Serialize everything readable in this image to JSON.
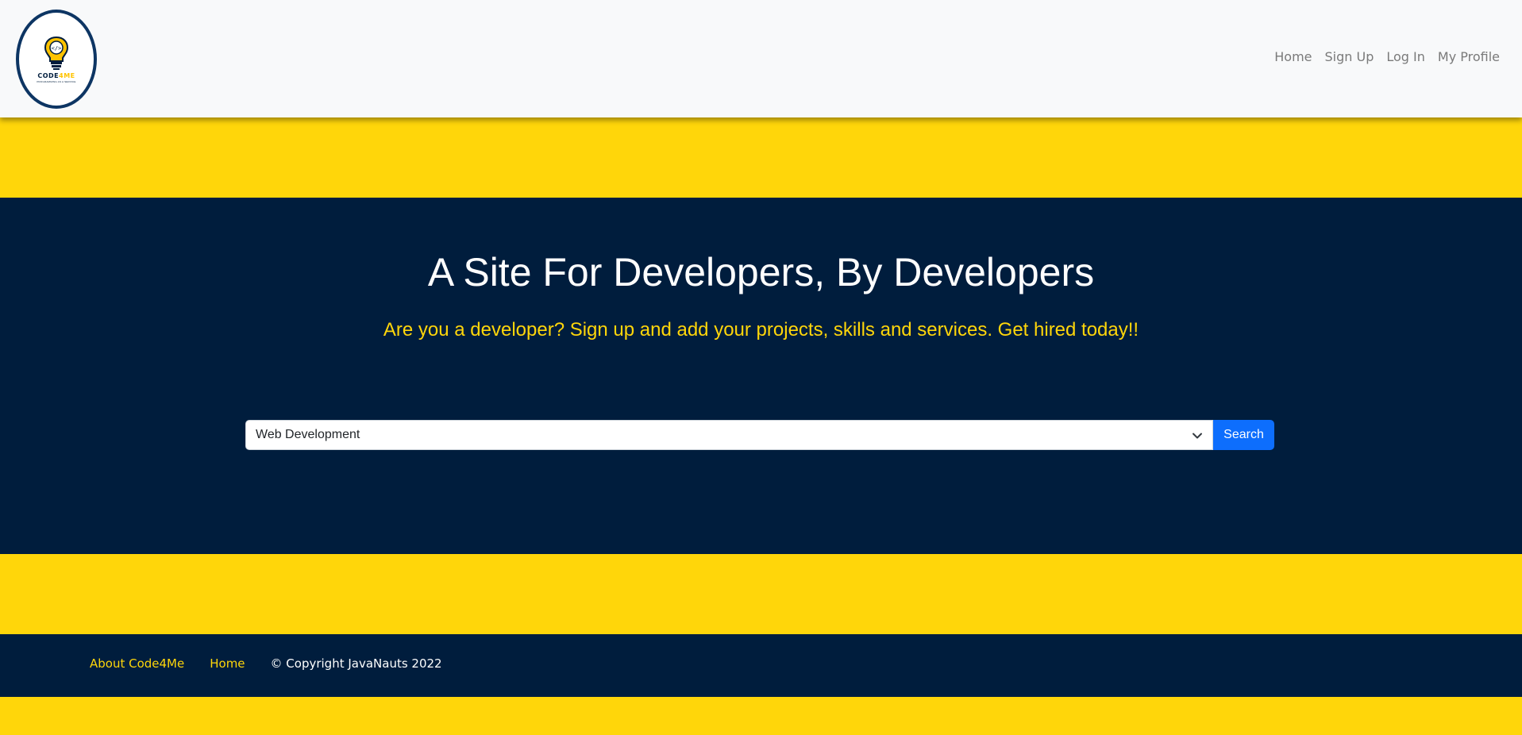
{
  "header": {
    "logo": {
      "brand_primary": "CODE",
      "brand_accent": "4ME",
      "tagline": "PROGRAMMING AS A SERVICE"
    },
    "nav": [
      {
        "label": "Home"
      },
      {
        "label": "Sign Up"
      },
      {
        "label": "Log In"
      },
      {
        "label": "My Profile"
      }
    ]
  },
  "hero": {
    "title": "A Site For Developers, By Developers",
    "subtitle": "Are you a developer? Sign up and add your projects, skills and services. Get hired today!!"
  },
  "search": {
    "selected_category": "Web Development",
    "button_label": "Search"
  },
  "footer": {
    "links": [
      {
        "label": "About Code4Me"
      },
      {
        "label": "Home"
      }
    ],
    "copyright": "© Copyright JavaNauts 2022"
  },
  "colors": {
    "navy": "#001d3d",
    "yellow": "#ffd60a",
    "button_blue": "#0d6efd",
    "navbar_bg": "#f8f9fa"
  }
}
